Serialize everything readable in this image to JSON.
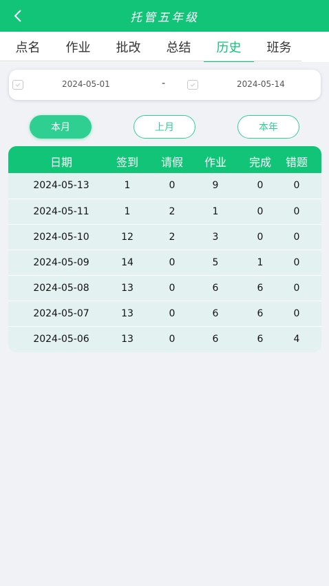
{
  "header": {
    "title": "托管五年级",
    "back_icon": "chevron-left-icon"
  },
  "tabs": [
    {
      "label": "点名",
      "active": false
    },
    {
      "label": "作业",
      "active": false
    },
    {
      "label": "批改",
      "active": false
    },
    {
      "label": "总结",
      "active": false
    },
    {
      "label": "历史",
      "active": true
    },
    {
      "label": "班务",
      "active": false
    }
  ],
  "date_range": {
    "start": "2024-05-01",
    "separator": "-",
    "end": "2024-05-14"
  },
  "quick_filters": [
    {
      "label": "本月",
      "selected": true
    },
    {
      "label": "上月",
      "selected": false
    },
    {
      "label": "本年",
      "selected": false
    }
  ],
  "table": {
    "headers": [
      "日期",
      "签到",
      "请假",
      "作业",
      "完成",
      "错题"
    ],
    "rows": [
      [
        "2024-05-13",
        "1",
        "0",
        "9",
        "0",
        "0"
      ],
      [
        "2024-05-11",
        "1",
        "2",
        "1",
        "0",
        "0"
      ],
      [
        "2024-05-10",
        "12",
        "2",
        "3",
        "0",
        "0"
      ],
      [
        "2024-05-09",
        "14",
        "0",
        "5",
        "1",
        "0"
      ],
      [
        "2024-05-08",
        "13",
        "0",
        "6",
        "6",
        "0"
      ],
      [
        "2024-05-07",
        "13",
        "0",
        "6",
        "6",
        "0"
      ],
      [
        "2024-05-06",
        "13",
        "0",
        "6",
        "6",
        "4"
      ]
    ]
  },
  "colors": {
    "accent": "#12c477",
    "button": "#2fcf91",
    "row_bg": "#e3f2f1",
    "page_bg": "#f1f2f6"
  }
}
